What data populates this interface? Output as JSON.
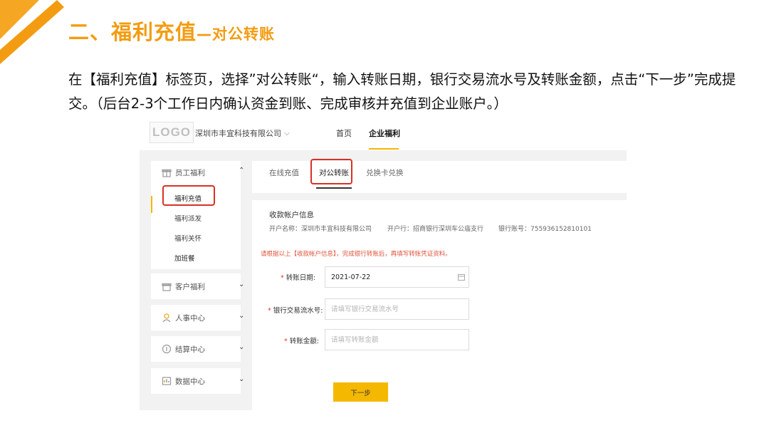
{
  "slide": {
    "title_main": "二、福利充值",
    "title_sub": "—对公转账",
    "description": "在【福利充值】标签页，选择”对公转账“，输入转账日期，银行交易流水号及转账金额，点击“下一步”完成提交。（后台2-3个工作日内确认资金到账、完成审核并充值到企业账户。）",
    "accent_color": "#f39c12"
  },
  "app": {
    "logo": "LOGO",
    "company": "深圳市丰宜科技有限公司",
    "nav": {
      "home": "首页",
      "welfare": "企业福利"
    },
    "sidebar": {
      "employee_welfare": {
        "label": "员工福利",
        "children": [
          "福利充值",
          "福利派发",
          "福利关怀",
          "加班餐"
        ]
      },
      "groups": [
        "客户福利",
        "人事中心",
        "结算中心",
        "数据中心"
      ]
    },
    "tabs": [
      "在线充值",
      "对公转账",
      "兑换卡兑换"
    ],
    "account": {
      "title": "收款帐户信息",
      "name": "开户名称：深圳市丰宜科技有限公司",
      "bank": "开户行：招商银行深圳车公庙支行",
      "number": "银行账号：755936152810101"
    },
    "notice": "请根据以上【收款帐户信息】，完成银行转账后，再填写转账凭证资料。",
    "form": {
      "date_label": "转账日期:",
      "date_value": "2021-07-22",
      "serial_label": "银行交易流水号:",
      "serial_placeholder": "请填写银行交易流水号",
      "amount_label": "转账金额:",
      "amount_placeholder": "请填写转账金额"
    },
    "next_button": "下一步",
    "highlight_color": "#d93025",
    "brand_color": "#f5b800"
  }
}
